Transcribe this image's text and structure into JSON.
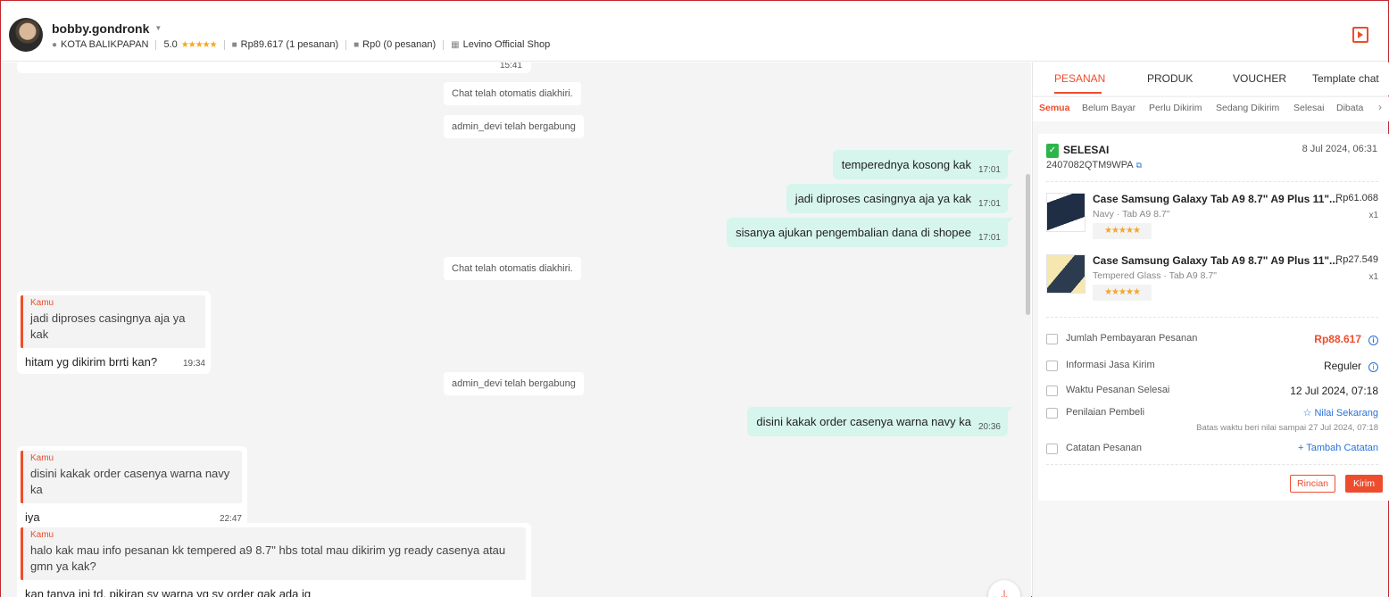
{
  "header": {
    "username": "bobby.gondronk",
    "location": "KOTA BALIKPAPAN",
    "rating": "5.0",
    "completed_orders": "Rp89.617 (1 pesanan)",
    "pending_orders": "Rp0 (0 pesanan)",
    "shop": "Levino Official Shop"
  },
  "chat": {
    "top_cut_time": "15:41",
    "messages": [
      {
        "type": "system",
        "text": "Chat telah otomatis diakhiri."
      },
      {
        "type": "system",
        "text": "admin_devi telah bergabung"
      },
      {
        "type": "out",
        "text": "temperednya kosong kak",
        "time": "17:01"
      },
      {
        "type": "out",
        "text": "jadi diproses casingnya aja ya kak",
        "time": "17:01"
      },
      {
        "type": "out",
        "text": "sisanya ajukan pengembalian dana di shopee",
        "time": "17:01"
      },
      {
        "type": "system",
        "text": "Chat telah otomatis diakhiri."
      },
      {
        "type": "in",
        "quote_author": "Kamu",
        "quote": "jadi diproses casingnya aja ya kak",
        "text": "hitam yg dikirim brrti kan?",
        "time": "19:34"
      },
      {
        "type": "system",
        "text": "admin_devi telah bergabung"
      },
      {
        "type": "out",
        "text": "disini kakak order casenya warna navy ka",
        "time": "20:36"
      },
      {
        "type": "in",
        "quote_author": "Kamu",
        "quote": "disini kakak order casenya warna navy ka",
        "text": "iya",
        "time": "22:47"
      },
      {
        "type": "in",
        "quote_author": "Kamu",
        "quote": "halo kak mau info pesanan kk tempered a9 8.7\" hbs total  mau dikirim yg ready casenya  atau gmn ya kak?",
        "text": "kan tanya ini td, pikiran sy warna yg sy order gak ada jg"
      }
    ]
  },
  "panel": {
    "tabs": [
      "PESANAN",
      "PRODUK",
      "VOUCHER",
      "Template chat"
    ],
    "subtabs": [
      "Semua",
      "Belum Bayar",
      "Perlu Dikirim",
      "Sedang Dikirim",
      "Selesai",
      "Dibata"
    ],
    "order": {
      "status": "SELESAI",
      "date": "8 Jul 2024, 06:31",
      "order_id": "2407082QTM9WPA",
      "products": [
        {
          "name": "Case Samsung Galaxy Tab A9 8.7\" A9 Plus 11\"...",
          "variant": "Navy · Tab A9 8.7\"",
          "price": "Rp61.068",
          "qty": "x1",
          "stars": "★★★★★"
        },
        {
          "name": "Case Samsung Galaxy Tab A9 8.7\" A9 Plus 11\"...",
          "variant": "Tempered Glass · Tab A9 8.7\"",
          "price": "Rp27.549",
          "qty": "x1",
          "stars": "★★★★★"
        }
      ],
      "payment_label": "Jumlah Pembayaran Pesanan",
      "payment_value": "Rp88.617",
      "shipping_label": "Informasi Jasa Kirim",
      "shipping_value": "Reguler",
      "completed_label": "Waktu Pesanan Selesai",
      "completed_value": "12 Jul 2024, 07:18",
      "review_label": "Penilaian Pembeli",
      "review_value": "☆ Nilai Sekarang",
      "review_deadline": "Batas waktu beri nilai sampai 27 Jul 2024, 07:18",
      "note_label": "Catatan Pesanan",
      "note_value": "+ Tambah Catatan",
      "btn_detail": "Rincian",
      "btn_send": "Kirim"
    }
  },
  "colors": {
    "accent": "#ee4d2d",
    "bubble_out": "#d6f5ec",
    "link": "#2673dd",
    "success": "#2db54b",
    "star": "#f5a623"
  }
}
